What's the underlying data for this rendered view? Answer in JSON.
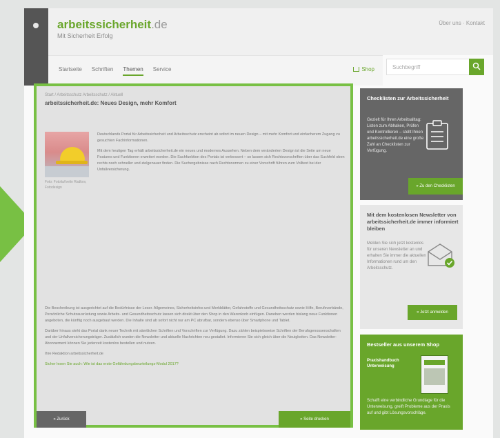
{
  "colors": {
    "accent": "#69a62b",
    "frame": "#78c044",
    "dark": "#666666"
  },
  "site": {
    "logo_main": "arbeitssicherheit",
    "logo_tld": ".de",
    "tagline": "Mit Sicherheit Erfolg",
    "top_right": "Über uns · Kontakt"
  },
  "nav": {
    "items": [
      "Startseite",
      "Schriften",
      "Themen",
      "Service"
    ],
    "shop_label": "Shop"
  },
  "search": {
    "placeholder": "Suchbegriff"
  },
  "article": {
    "breadcrumb": "Start / Arbeitsschutz Arbeitsschutz / Aktuell",
    "title": "arbeitssicherheit.de: Neues Design, mehr Komfort",
    "image_caption": "Foto: Fotolia/Ivelin Radkov, Fotodesign",
    "intro": [
      "Deutschlands Portal für Arbeitssicherheit und Arbeitsschutz erscheint ab sofort im neuen Design – mit mehr Komfort und einfacherem Zugang zu gesuchten Fachinformationen.",
      "Mit dem heutigen Tag erhält arbeitssicherheit.de ein neues und modernes Aussehen. Neben dem veränderten Design ist die Seite um neue Features und Funktionen erweitert worden. Die Suchfunktion des Portals ist verbessert – so lassen sich Rechtsvorschriften über das Suchfeld oben rechts noch schneller und zielgenauer finden. Die Suchergebnisse nach Rechtsnormen zu einer Vorschrift führen zum Volltext bei der Unfallversicherung."
    ],
    "body": [
      "Die Beschreibung ist ausgerichtet auf die Bedürfnisse der Leser. Allgemeines, Sicherheitsinfos und Merkblätter, Gefahrstoffe und Gesundheitsschutz sowie Hilfe, Berufsverbände, Persönliche Schutzausrüstung sowie Arbeits- und Gesundheitsschutz lassen sich direkt über den Shop in den Warenkorb einfügen. Daneben werden bislang neue Funktionen angeboten, die künftig noch ausgebaut werden. Die Inhalte sind ab sofort nicht nur am PC abrufbar, sondern ebenso über Smartphone und Tablet.",
      "Darüber hinaus steht das Portal dank neuer Technik mit sämtlichen Schriften und Vorschriften zur Verfügung. Dazu zählen beispielsweise Schriften der Berufsgenossenschaften und der Unfallversicherungsträger. Zusätzlich wurden die Newsletter und aktuelle Nachrichten neu gestaltet. Informieren Sie sich gleich über die Neuigkeiten. Das Newsletter-Abonnement können Sie jederzeit kostenlos bestellen und nutzen.",
      "Ihre Redaktion arbeitssicherheit.de",
      "Sicher lesen Sie auch: Wie ist das erste Gefährdungsbeurteilungs-Modul 2017?"
    ],
    "back_label": "« Zurück",
    "print_label": "» Seite drucken"
  },
  "sidebar": {
    "checklist": {
      "title": "Checklisten zur Arbeitssicherheit",
      "text": "Gezielt für Ihren Arbeitsalltag: Listen zum Abhaken, Prüfen und Kontrollieren – stellt Ihnen arbeitssicherheit.de eine große Zahl an Checklisten zur Verfügung.",
      "button": "» Zu den Checklisten"
    },
    "newsletter": {
      "title": "Mit dem kostenlosen Newsletter von arbeitssicherheit.de immer informiert bleiben",
      "text": "Melden Sie sich jetzt kostenlos für unseren Newsletter an und erhalten Sie immer die aktuellen Informationen rund um den Arbeitsschutz.",
      "button": "» Jetzt anmelden"
    },
    "shop": {
      "title": "Bestseller aus unserem Shop",
      "product": "Praxishandbuch Unterweisung",
      "text": "Schafft eine verbindliche Grundlage für die Unterweisung, greift Probleme aus der Praxis auf und gibt Lösungsvorschläge."
    }
  }
}
